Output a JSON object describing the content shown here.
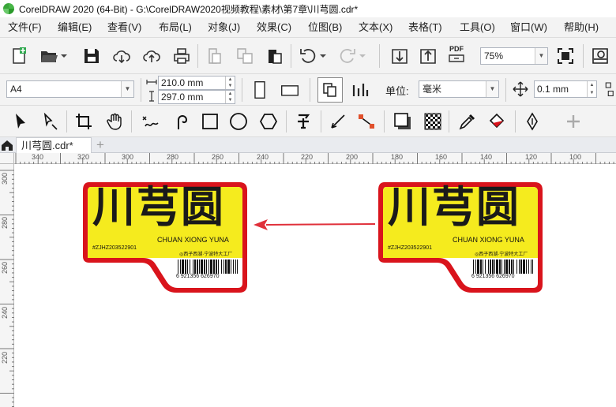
{
  "app": {
    "title": "CorelDRAW 2020 (64-Bit) - G:\\CorelDRAW2020视频教程\\素材\\第7章\\川芎圆.cdr*"
  },
  "menu": [
    "文件(F)",
    "编辑(E)",
    "查看(V)",
    "布局(L)",
    "对象(J)",
    "效果(C)",
    "位图(B)",
    "文本(X)",
    "表格(T)",
    "工具(O)",
    "窗口(W)",
    "帮助(H)"
  ],
  "standard_toolbar": {
    "zoom_value": "75%",
    "pdf_label": "PDF"
  },
  "property_bar": {
    "page_size": "A4",
    "width": "210.0 mm",
    "height": "297.0 mm",
    "units_label": "单位:",
    "units_value": "毫米",
    "nudge_value": "0.1 mm"
  },
  "tabs": {
    "document_tab": "川芎圆.cdr*",
    "add_tab": "+"
  },
  "ruler": {
    "horizontal_labels": [
      "340",
      "320",
      "300",
      "280",
      "260",
      "240",
      "220",
      "200",
      "180",
      "160",
      "140",
      "120",
      "100"
    ],
    "vertical_labels": [
      "300",
      "280",
      "260",
      "240",
      "220"
    ]
  },
  "labels": [
    {
      "title": "川芎圆",
      "subtitle": "CHUAN XIONG YUNA",
      "code": "#ZJHZ203522901",
      "maker": "◎西子西湖·宁波特大工厂",
      "barcode": "6 921356 626970"
    },
    {
      "title": "川芎圆",
      "subtitle": "CHUAN XIONG YUNA",
      "code": "#ZJHZ203522901",
      "maker": "◎西子西湖·宁波特大工厂",
      "barcode": "6 921356 626970"
    }
  ],
  "colors": {
    "label_red": "#d9141c",
    "label_yellow": "#f5eb1e",
    "arrow_red": "#e0303a",
    "title_black": "#1a1a1a"
  }
}
